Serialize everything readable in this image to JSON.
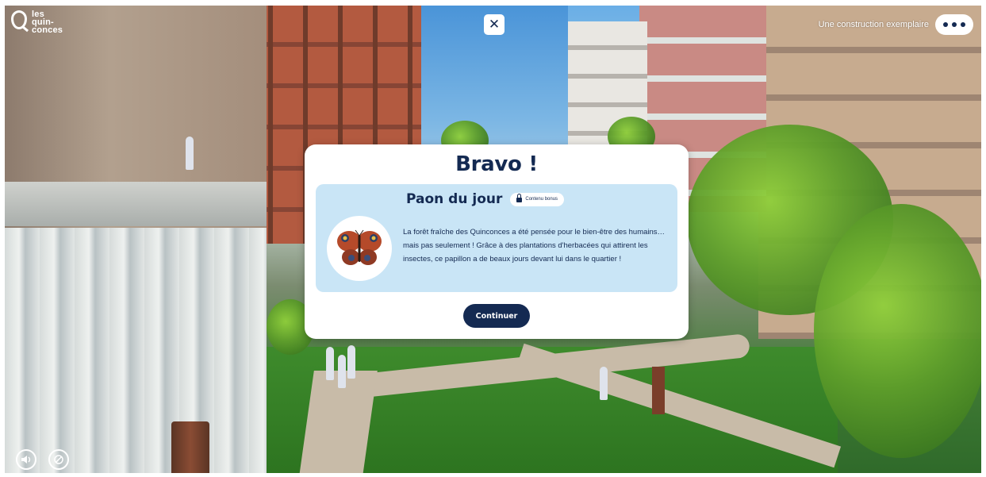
{
  "header": {
    "logo_lines": [
      "les",
      "quin-",
      "conces"
    ],
    "close_symbol": "✕",
    "top_right_label": "Une construction exemplaire"
  },
  "modal": {
    "title": "Bravo !",
    "card_title": "Paon du jour",
    "badge_label": "Contenu bonus",
    "body_text": "La forêt fraîche des Quinconces a été pensée pour le bien-être des humains… mais pas seulement ! Grâce à des plantations d'herbacées qui attirent les insectes, ce papillon a de beaux jours devant lui dans le quartier !",
    "continue_label": "Continuer"
  },
  "icons": {
    "close": "close-icon",
    "more": "more-dots-icon",
    "lock": "lock-icon",
    "butterfly": "butterfly-icon",
    "bottom_left_1": "audio-icon",
    "bottom_left_2": "disable-icon"
  },
  "colors": {
    "navy": "#142a52",
    "card_bg": "#c9e5f6",
    "white": "#ffffff"
  }
}
